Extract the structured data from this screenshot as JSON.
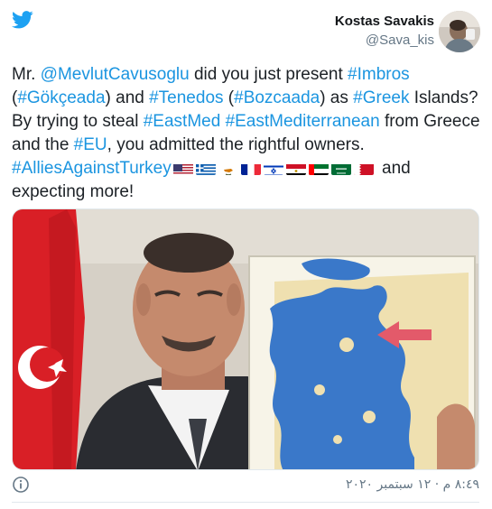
{
  "author": {
    "name": "Kostas Savakis",
    "handle": "@Sava_kis"
  },
  "tweet": {
    "segments": [
      {
        "text": "Mr. ",
        "type": "plain"
      },
      {
        "text": "@MevlutCavusoglu",
        "type": "link"
      },
      {
        "text": " did you just present ",
        "type": "plain"
      },
      {
        "text": "#Imbros",
        "type": "link"
      },
      {
        "text": " (",
        "type": "plain"
      },
      {
        "text": "#Gökçeada",
        "type": "link"
      },
      {
        "text": ") and ",
        "type": "plain"
      },
      {
        "text": "#Tenedos",
        "type": "link"
      },
      {
        "text": " (",
        "type": "plain"
      },
      {
        "text": "#Bozcaada",
        "type": "link"
      },
      {
        "text": ") as ",
        "type": "plain"
      },
      {
        "text": "#Greek",
        "type": "link"
      },
      {
        "text": " Islands? By trying to steal ",
        "type": "plain"
      },
      {
        "text": "#EastMed",
        "type": "link"
      },
      {
        "text": " ",
        "type": "plain"
      },
      {
        "text": "#EastMediterranean",
        "type": "link"
      },
      {
        "text": "  from Greece and the ",
        "type": "plain"
      },
      {
        "text": "#EU",
        "type": "link"
      },
      {
        "text": ", you admitted the rightful owners. ",
        "type": "plain"
      },
      {
        "text": "#AlliesAgainstTurkey",
        "type": "link"
      }
    ],
    "flags": [
      "us-flag",
      "greece-flag",
      "cyprus-flag",
      "france-flag",
      "israel-flag",
      "egypt-flag",
      "uae-flag",
      "saudi-flag",
      "bahrain-flag"
    ],
    "closing": " and expecting more!"
  },
  "media": {
    "icon": "photo-image"
  },
  "footer": {
    "timestamp": "٨:٤٩ م · ١٢ سبتمبر ٢٠٢٠",
    "info_icon": "info-icon"
  },
  "colors": {
    "link": "#1b95e0",
    "twitter_blue": "#1da1f2",
    "text": "#1c2126",
    "muted": "#657786"
  }
}
